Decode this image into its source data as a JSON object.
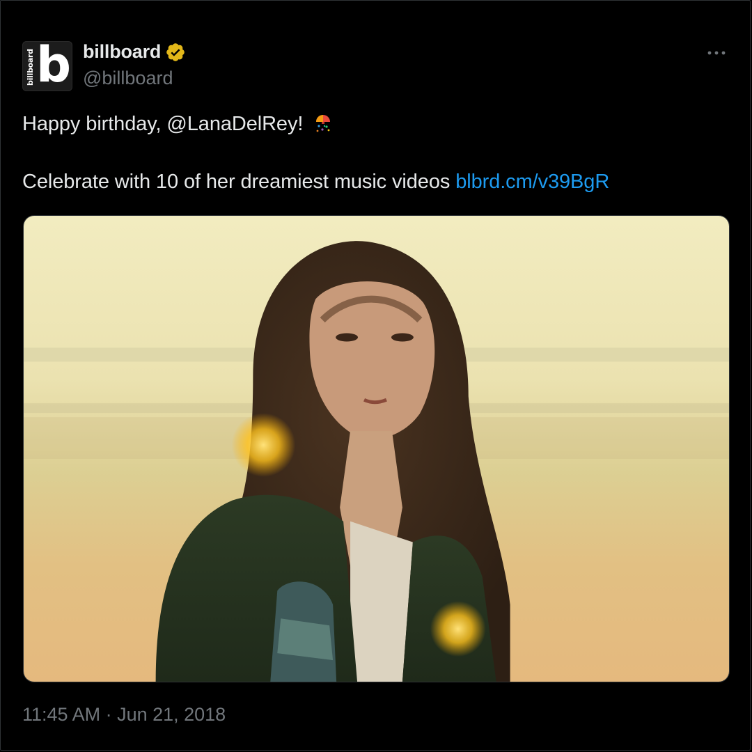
{
  "author": {
    "display_name": "billboard",
    "handle": "@billboard",
    "avatar_letter": "b",
    "avatar_vertical_text": "billboard",
    "verified_color": "#e2b719"
  },
  "tweet": {
    "line1_text": "Happy birthday, @LanaDelRey!",
    "line1_emoji": "confetti-ball-icon",
    "line2_text": "Celebrate with 10 of her dreamiest music videos",
    "link_text": "blbrd.cm/v39BgR"
  },
  "media": {
    "description_icon": "photo"
  },
  "timestamp": "11:45 AM · Jun 21, 2018",
  "colors": {
    "background": "#000000",
    "text": "#e7e9ea",
    "secondary": "#71767b",
    "link": "#1d9bf0"
  }
}
